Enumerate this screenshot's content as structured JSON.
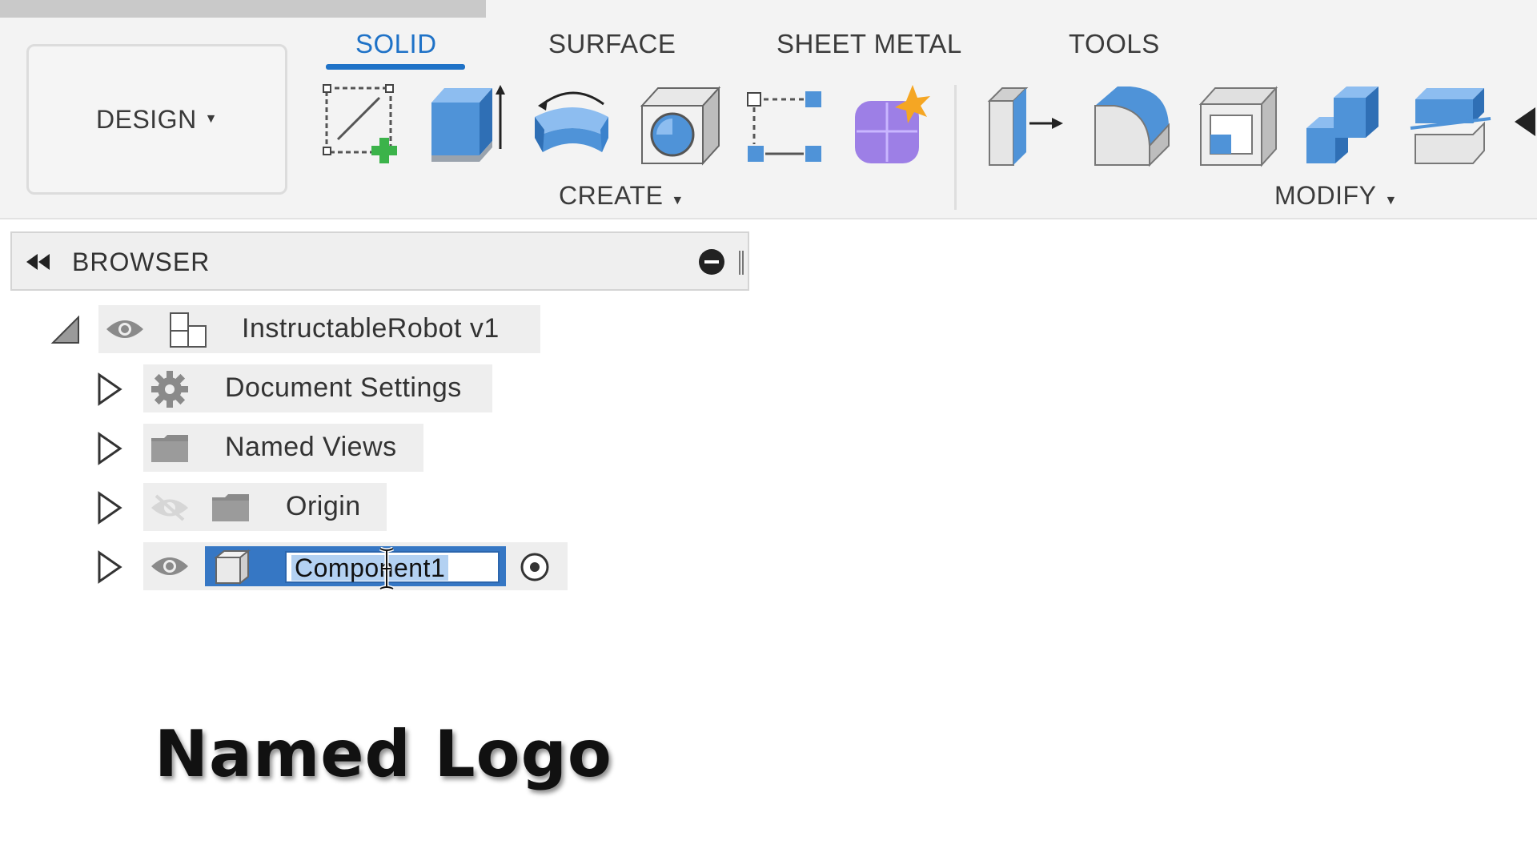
{
  "workspace": {
    "label": "DESIGN"
  },
  "tabs": [
    {
      "label": "SOLID",
      "active": true
    },
    {
      "label": "SURFACE",
      "active": false
    },
    {
      "label": "SHEET METAL",
      "active": false
    },
    {
      "label": "TOOLS",
      "active": false
    }
  ],
  "create_group": {
    "label": "CREATE",
    "tools": [
      "create-sketch-icon",
      "extrude-icon",
      "revolve-icon",
      "hole-icon",
      "rectangular-pattern-icon",
      "form-icon"
    ]
  },
  "modify_group": {
    "label": "MODIFY",
    "tools": [
      "press-pull-icon",
      "fillet-icon",
      "shell-icon",
      "combine-icon",
      "split-body-icon"
    ]
  },
  "browser": {
    "title": "BROWSER",
    "root": {
      "label": "InstructableRobot v1"
    },
    "items": [
      {
        "label": "Document Settings",
        "icon": "gear-icon"
      },
      {
        "label": "Named Views",
        "icon": "folder-icon"
      },
      {
        "label": "Origin",
        "icon": "folder-icon",
        "visible": false
      },
      {
        "label": "Component1",
        "icon": "component-icon",
        "editing": true
      }
    ]
  },
  "caption": "Named Logo",
  "colors": {
    "accent": "#1f72c7",
    "selection": "#3677c4",
    "tool_blue": "#4f93d8",
    "form_purple": "#9d7fe6"
  }
}
